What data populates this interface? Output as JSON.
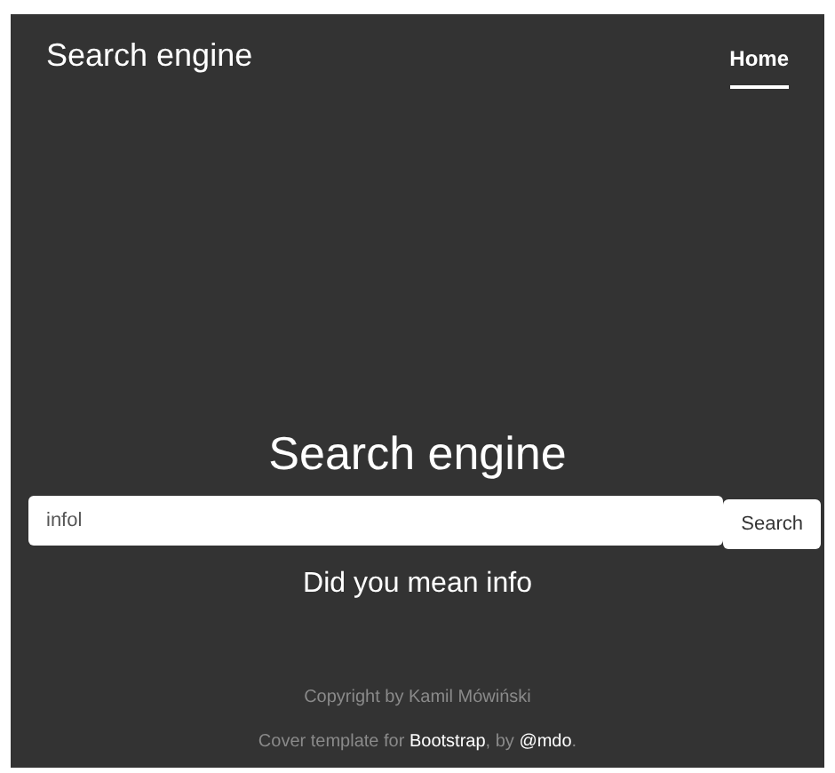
{
  "header": {
    "brand": "Search engine",
    "nav": [
      {
        "label": "Home",
        "selected": true
      }
    ]
  },
  "main": {
    "heading": "Search engine",
    "search": {
      "value": "infol",
      "button": "Search"
    },
    "suggestion": "Did you mean info"
  },
  "footer": {
    "copyright": "Copyright by Kamil Mówiński",
    "credit": [
      {
        "kind": "text",
        "text": "Cover template for "
      },
      {
        "kind": "link",
        "text": "Bootstrap"
      },
      {
        "kind": "text",
        "text": ", by "
      },
      {
        "kind": "link",
        "text": "@mdo"
      },
      {
        "kind": "text",
        "text": "."
      }
    ]
  }
}
